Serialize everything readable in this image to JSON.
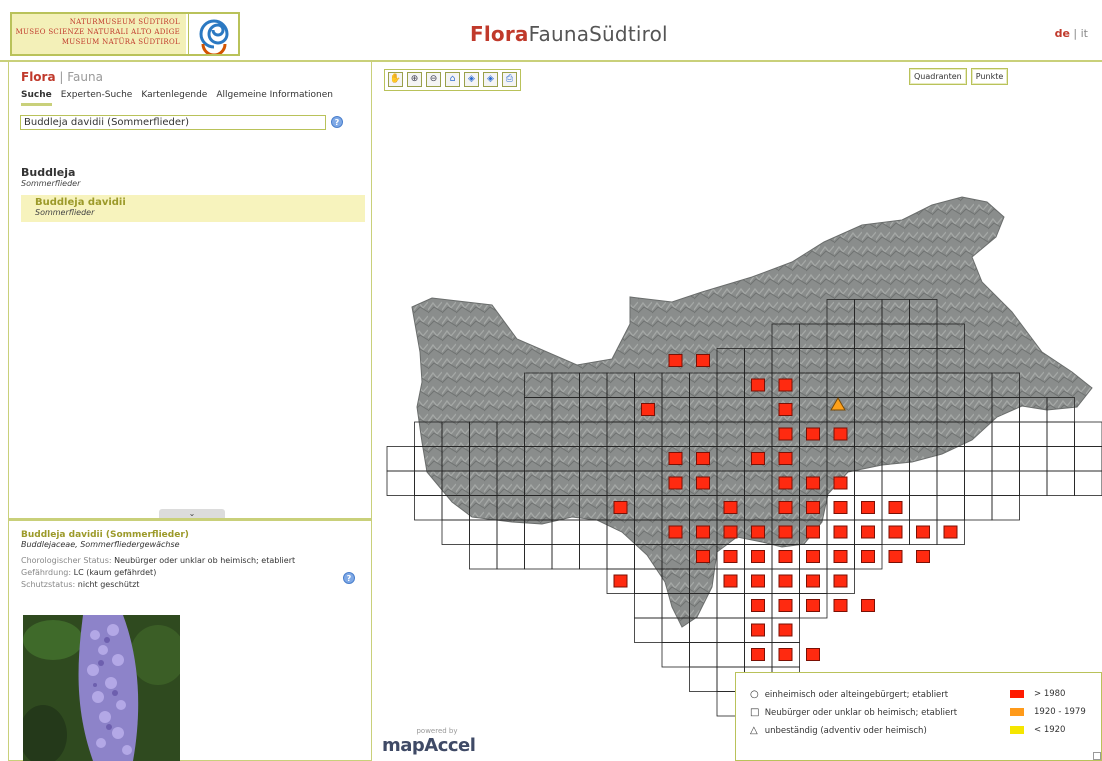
{
  "header": {
    "logo_lines": [
      "NATURMUSEUM SÜDTIROL",
      "MUSEO SCIENZE NATURALI ALTO ADIGE",
      "MUSEUM NATÜRA SÜDTIROL"
    ],
    "site_title_highlight": "Flora",
    "site_title_rest": "FaunaSüdtirol",
    "lang_active": "de",
    "lang_separator": " | ",
    "lang_other": "it"
  },
  "sidebar": {
    "flora": "Flora",
    "separator": " | ",
    "fauna": "Fauna",
    "tabs": [
      {
        "label": "Suche",
        "active": true
      },
      {
        "label": "Experten-Suche",
        "active": false
      },
      {
        "label": "Kartenlegende",
        "active": false
      },
      {
        "label": "Allgemeine Informationen",
        "active": false
      }
    ],
    "search_value": "Buddleja davidii (Sommerflieder)",
    "help_glyph": "?",
    "results": {
      "genus": "Buddleja",
      "genus_common": "Sommerflieder",
      "species": "Buddleja davidii",
      "species_common": "Sommerflieder"
    },
    "expand_glyph": "⌄"
  },
  "detail": {
    "title": "Buddleja davidii (Sommerflieder)",
    "family": "Buddlejaceae, Sommerfliedergewächse",
    "chorological_label": "Chorologischer Status:",
    "chorological_value": "Neubürger oder unklar ob heimisch; etabliert",
    "threat_label": "Gefährdung:",
    "threat_value": "LC (kaum gefährdet)",
    "protection_label": "Schutzstatus:",
    "protection_value": "nicht geschützt"
  },
  "map": {
    "tools": [
      {
        "name": "pan-icon",
        "glyph": "✋"
      },
      {
        "name": "zoom-in-icon",
        "glyph": "⊕"
      },
      {
        "name": "zoom-out-icon",
        "glyph": "⊖"
      },
      {
        "name": "home-icon",
        "glyph": "⌂"
      },
      {
        "name": "layers-icon",
        "glyph": "◈"
      },
      {
        "name": "layers-alt-icon",
        "glyph": "◈"
      },
      {
        "name": "print-icon",
        "glyph": "⎙"
      }
    ],
    "mode_buttons": [
      "Quadranten",
      "Punkte"
    ],
    "powered_by": "powered by",
    "brand": "mapAccel",
    "legend": {
      "status": [
        {
          "symbol": "○",
          "label": "einheimisch oder alteingebürgert; etabliert"
        },
        {
          "symbol": "□",
          "label": "Neubürger oder unklar ob heimisch; etabliert"
        },
        {
          "symbol": "△",
          "label": "unbeständig (adventiv oder heimisch)"
        }
      ],
      "periods": [
        {
          "label": "> 1980",
          "color": "#ff1a00"
        },
        {
          "label": "1920 - 1979",
          "color": "#ff9a1a"
        },
        {
          "label": "< 1920",
          "color": "#f5e600"
        }
      ]
    },
    "colors": {
      "record_fill": "#ff2a10",
      "record_stroke": "#7a1005",
      "triangle_fill": "#ffa11a",
      "accent": "#c9d07a",
      "brand_red": "#c0392b"
    },
    "occurrences": [
      [
        1,
        3
      ],
      [
        1,
        2
      ],
      [
        2,
        5
      ],
      [
        2,
        6
      ],
      [
        3,
        1
      ],
      [
        3,
        6
      ],
      [
        4,
        6
      ],
      [
        4,
        7
      ],
      [
        4,
        8
      ],
      [
        5,
        2
      ],
      [
        5,
        3
      ],
      [
        5,
        5
      ],
      [
        5,
        6
      ],
      [
        6,
        2
      ],
      [
        6,
        3
      ],
      [
        6,
        6
      ],
      [
        6,
        7
      ],
      [
        6,
        8
      ],
      [
        7,
        0
      ],
      [
        7,
        4
      ],
      [
        7,
        6
      ],
      [
        7,
        7
      ],
      [
        7,
        8
      ],
      [
        7,
        9
      ],
      [
        7,
        10
      ],
      [
        8,
        2
      ],
      [
        8,
        3
      ],
      [
        8,
        4
      ],
      [
        8,
        5
      ],
      [
        8,
        6
      ],
      [
        8,
        7
      ],
      [
        8,
        8
      ],
      [
        8,
        9
      ],
      [
        8,
        10
      ],
      [
        8,
        11
      ],
      [
        8,
        12
      ],
      [
        9,
        3
      ],
      [
        9,
        4
      ],
      [
        9,
        5
      ],
      [
        9,
        6
      ],
      [
        9,
        7
      ],
      [
        9,
        8
      ],
      [
        9,
        9
      ],
      [
        9,
        10
      ],
      [
        9,
        11
      ],
      [
        10,
        0
      ],
      [
        10,
        4
      ],
      [
        10,
        5
      ],
      [
        10,
        6
      ],
      [
        10,
        7
      ],
      [
        10,
        8
      ],
      [
        11,
        5
      ],
      [
        11,
        6
      ],
      [
        11,
        7
      ],
      [
        11,
        8
      ],
      [
        11,
        9
      ],
      [
        12,
        5
      ],
      [
        12,
        6
      ],
      [
        13,
        5
      ],
      [
        13,
        6
      ],
      [
        13,
        7
      ],
      [
        14,
        5
      ],
      [
        15,
        5
      ]
    ]
  }
}
